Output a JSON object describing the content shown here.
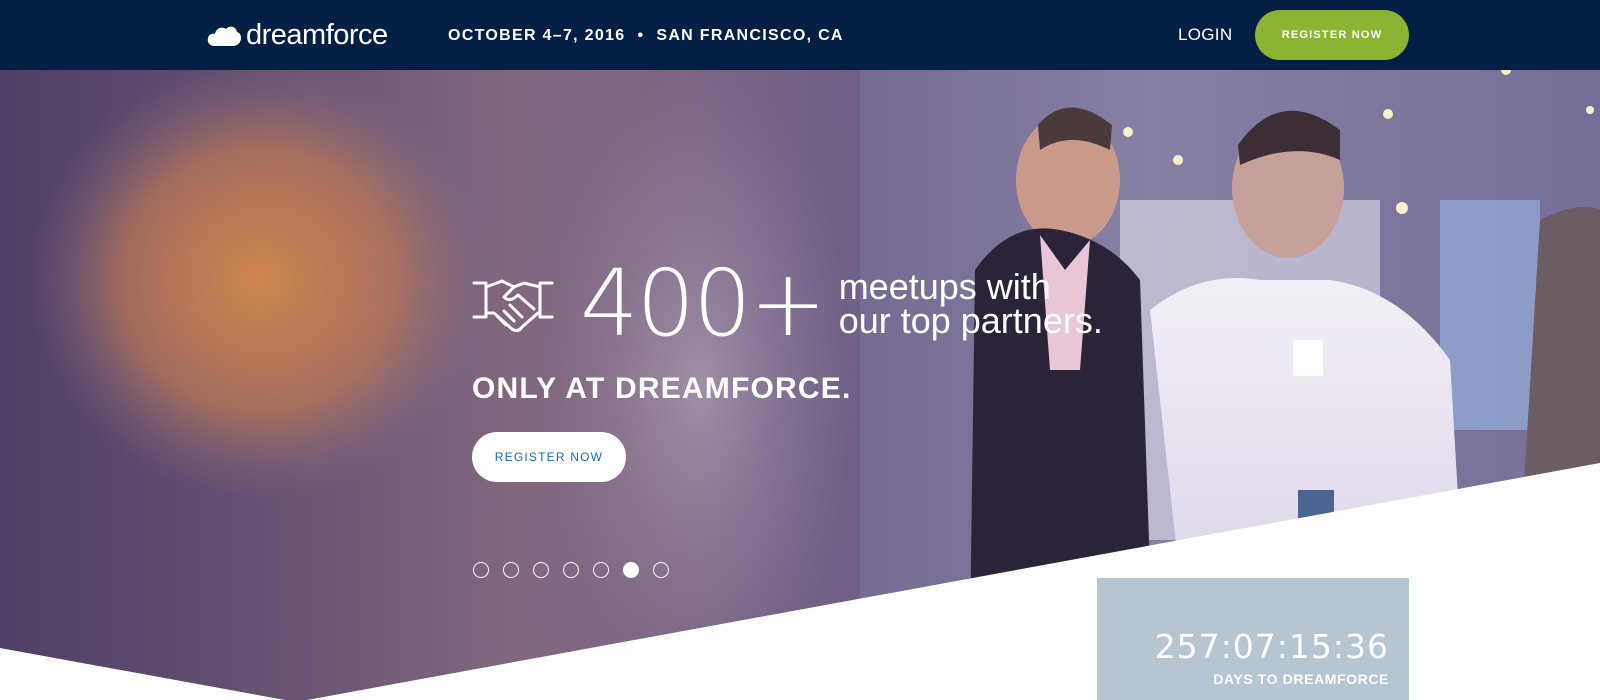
{
  "nav": {
    "logo_text": "dreamforce",
    "event_dates": "OCTOBER 4–7, 2016",
    "separator": "•",
    "event_location": "SAN FRANCISCO, CA",
    "login_label": "LOGIN",
    "register_label": "REGISTER NOW"
  },
  "hero": {
    "icon": "handshake-icon",
    "stat_number": "400+",
    "stat_line1": "meetups with",
    "stat_line2": "our top partners.",
    "tagline": "ONLY AT DREAMFORCE.",
    "register_label": "REGISTER NOW",
    "slides_total": 7,
    "active_slide": 6
  },
  "countdown": {
    "time": "257:07:15:36",
    "label": "DAYS TO DREAMFORCE"
  },
  "colors": {
    "nav_bg": "#032044",
    "register_green": "#8cb332",
    "hero_button_text": "#1a6ba8",
    "countdown_bg": "#b6c6d1"
  }
}
